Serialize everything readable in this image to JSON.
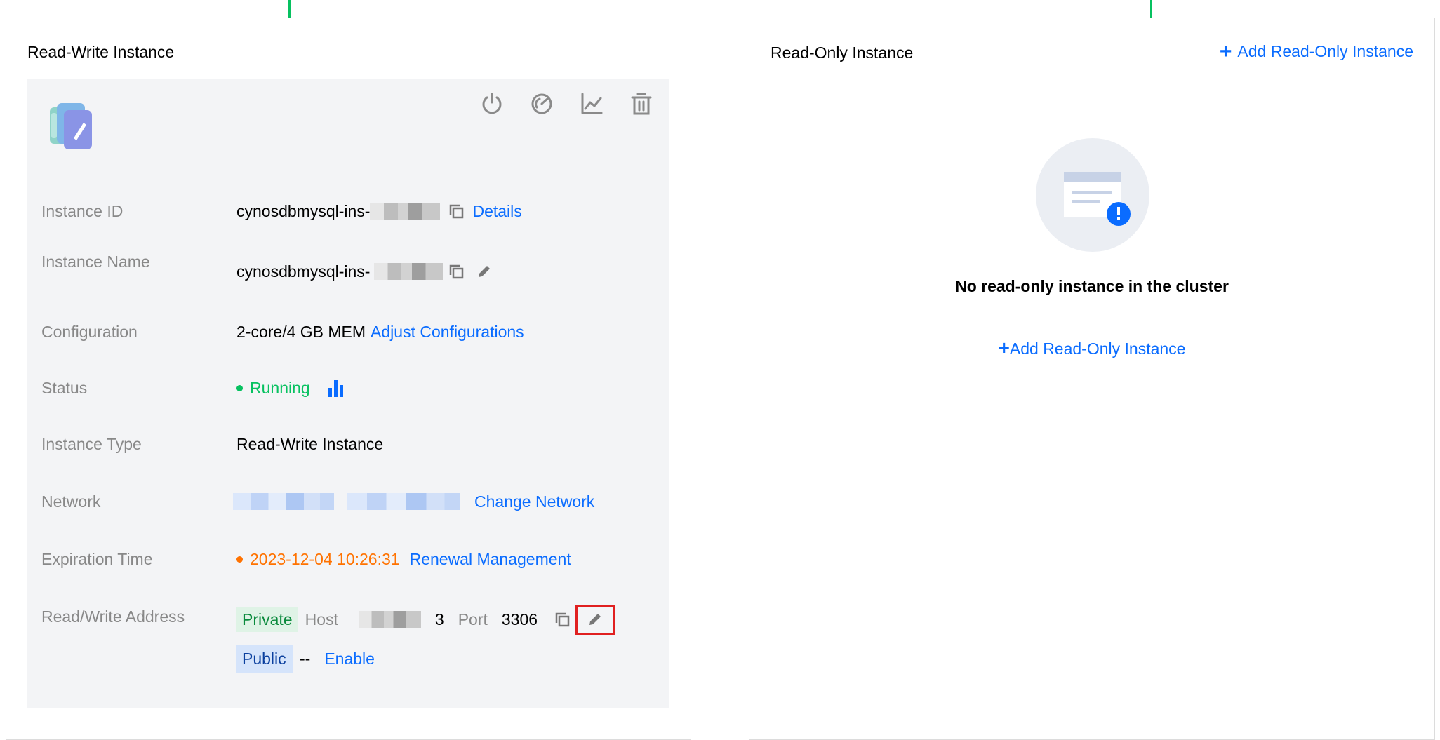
{
  "colors": {
    "accent": "#0a6cff",
    "running": "#07c160",
    "expiring": "#ff7200",
    "highlight": "#e02020"
  },
  "rw_panel": {
    "title": "Read-Write Instance",
    "toolbar_icons": [
      "power-icon",
      "speed-gauge-icon",
      "line-chart-icon",
      "trash-icon"
    ],
    "rows": {
      "instance_id": {
        "label": "Instance ID",
        "value": "cynosdbmysql-ins-",
        "details_link": "Details"
      },
      "instance_name": {
        "label": "Instance Name",
        "value": "cynosdbmysql-ins-"
      },
      "configuration": {
        "label": "Configuration",
        "value": "2-core/4 GB MEM",
        "adjust_link": "Adjust Configurations"
      },
      "status": {
        "label": "Status",
        "value": "Running"
      },
      "instance_type": {
        "label": "Instance Type",
        "value": "Read-Write Instance"
      },
      "network": {
        "label": "Network",
        "change_link": "Change Network"
      },
      "expiration": {
        "label": "Expiration Time",
        "value": "2023-12-04 10:26:31",
        "renewal_link": "Renewal Management"
      },
      "address": {
        "label": "Read/Write Address",
        "private_tag": "Private",
        "host_label": "Host",
        "host_suffix": "3",
        "port_label": "Port",
        "port_value": "3306",
        "public_tag": "Public",
        "public_value": "--",
        "enable_link": "Enable"
      }
    }
  },
  "ro_panel": {
    "title": "Read-Only Instance",
    "add_link_top": "Add Read-Only Instance",
    "empty_message": "No read-only instance in the cluster",
    "add_link_center": "Add Read-Only Instance"
  }
}
